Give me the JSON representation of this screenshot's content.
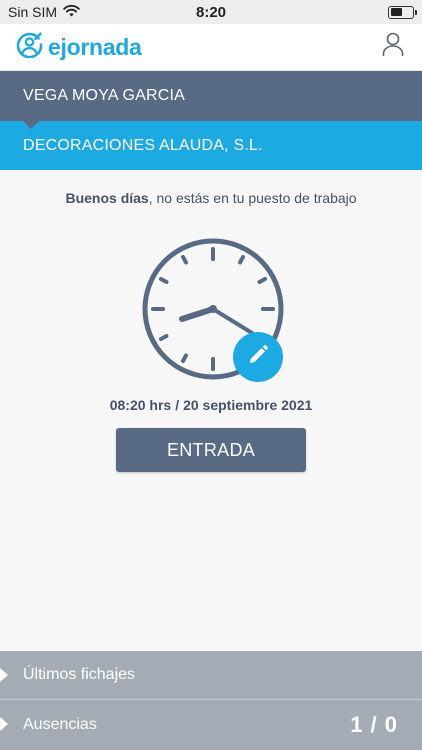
{
  "status_bar": {
    "carrier": "Sin SIM",
    "time": "8:20",
    "icons": [
      "wifi-icon",
      "battery-icon"
    ],
    "battery_level": 0.55
  },
  "header": {
    "logo_text": "ejornada",
    "logo_icon": "ejornada-logo-icon",
    "user_icon": "user-icon"
  },
  "user": {
    "name": "VEGA MOYA GARCIA"
  },
  "company": {
    "name": "DECORACIONES ALAUDA, S.L."
  },
  "main": {
    "greeting_bold": "Buenos días",
    "greeting_rest": ", no estás en tu puesto de trabajo",
    "time": "08:20 hrs",
    "separator": "/",
    "date": "20 septiembre 2021",
    "entrada_label": "ENTRADA",
    "edit_icon": "pencil-icon",
    "clock_icon": "clock-icon"
  },
  "bottom": {
    "items": [
      {
        "label": "Últimos fichajes",
        "count": ""
      },
      {
        "label": "Ausencias",
        "count": "1 / 0"
      }
    ]
  },
  "colors": {
    "accent_blue": "#1da9e1",
    "slate": "#586a84",
    "bottom_gray": "#a3abb5",
    "background": "#f7f7f7"
  }
}
